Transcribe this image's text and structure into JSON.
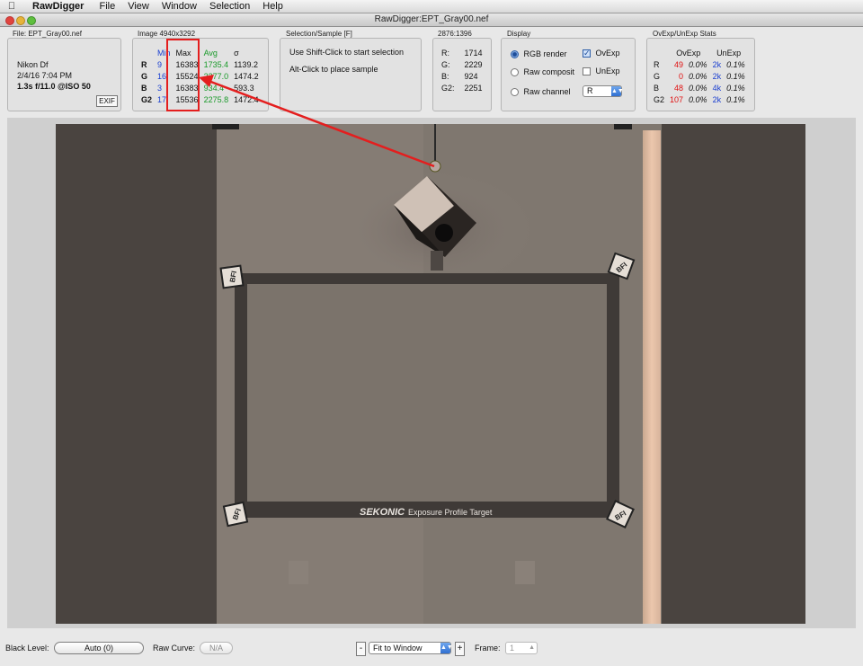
{
  "menubar": {
    "app_name": "RawDigger",
    "items": [
      "File",
      "View",
      "Window",
      "Selection",
      "Help"
    ]
  },
  "window": {
    "title": "RawDigger:EPT_Gray00.nef"
  },
  "file_panel": {
    "label": "File: EPT_Gray00.nef",
    "camera": "Nikon Df",
    "date": "2/4/16 7:04 PM",
    "exposure": "1.3s f/11.0 @ISO 50",
    "exif_button": "EXIF"
  },
  "image_panel": {
    "label": "Image 4940x3292",
    "headers": [
      "Min",
      "Max",
      "Avg",
      "σ"
    ],
    "rows": [
      {
        "channel": "R",
        "min": "9",
        "max": "16383",
        "avg": "1735.4",
        "sigma": "1139.2"
      },
      {
        "channel": "G",
        "min": "16",
        "max": "15524",
        "avg": "2277.0",
        "sigma": "1474.2"
      },
      {
        "channel": "B",
        "min": "3",
        "max": "16383",
        "avg": "934.4",
        "sigma": "593.3"
      },
      {
        "channel": "G2",
        "min": "17",
        "max": "15536",
        "avg": "2275.8",
        "sigma": "1472.4"
      }
    ]
  },
  "selection_panel": {
    "label": "Selection/Sample [F]",
    "line1": "Use Shift-Click to start selection",
    "line2": "Alt-Click to place sample"
  },
  "coords_panel": {
    "label": "2876:1396",
    "rows": [
      {
        "channel": "R:",
        "value": "1714"
      },
      {
        "channel": "G:",
        "value": "2229"
      },
      {
        "channel": "B:",
        "value": "924"
      },
      {
        "channel": "G2:",
        "value": "2251"
      }
    ]
  },
  "display_panel": {
    "label": "Display",
    "rgb_render": "RGB render",
    "raw_composit": "Raw composit",
    "raw_channel": "Raw channel",
    "ovexp": "OvExp",
    "unexp": "UnExp",
    "channel_select": "R",
    "selected_mode": "RGB render",
    "ovexp_checked": true,
    "unexp_checked": false
  },
  "stats_panel": {
    "label": "OvExp/UnExp Stats",
    "headers": [
      "OvExp",
      "UnExp"
    ],
    "rows": [
      {
        "channel": "R",
        "ov_count": "49",
        "ov_pct": "0.0%",
        "un_count": "2k",
        "un_pct": "0.1%"
      },
      {
        "channel": "G",
        "ov_count": "0",
        "ov_pct": "0.0%",
        "un_count": "2k",
        "un_pct": "0.1%"
      },
      {
        "channel": "B",
        "ov_count": "48",
        "ov_pct": "0.0%",
        "un_count": "4k",
        "un_pct": "0.1%"
      },
      {
        "channel": "G2",
        "ov_count": "107",
        "ov_pct": "0.0%",
        "un_count": "2k",
        "un_pct": "0.1%"
      }
    ]
  },
  "image_content": {
    "target_brand": "SEKONIC",
    "target_caption": "Exposure Profile Target",
    "corner_mark": "BFI"
  },
  "bottom": {
    "black_level_label": "Black Level:",
    "black_level_value": "Auto (0)",
    "raw_curve_label": "Raw Curve:",
    "raw_curve_value": "N/A",
    "zoom_minus": "-",
    "zoom_value": "Fit to Window",
    "zoom_plus": "+",
    "frame_label": "Frame:",
    "frame_value": "1"
  },
  "colors": {
    "min_blue": "#1a3fd0",
    "avg_green": "#1a9a2a",
    "ovexp_red": "#e01010",
    "annotation_red": "#e41e1e"
  },
  "icons": [
    "apple-icon",
    "close-light",
    "minimize-light",
    "zoom-light",
    "select-arrow-icon",
    "stepper-icon"
  ]
}
